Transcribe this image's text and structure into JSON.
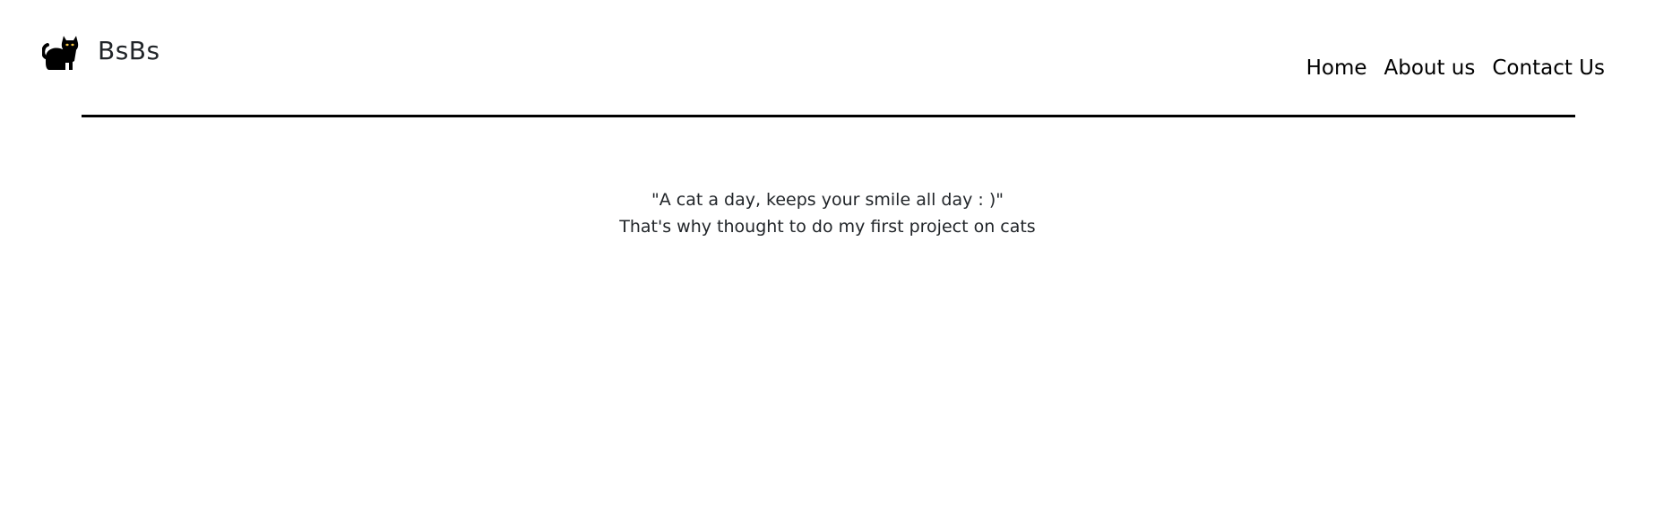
{
  "brand": {
    "icon": "cat-icon",
    "name": "BsBs"
  },
  "nav": {
    "items": [
      {
        "label": "Home"
      },
      {
        "label": "About us"
      },
      {
        "label": "Contact Us"
      }
    ]
  },
  "main": {
    "quote": "\"A cat a day, keeps your smile all day : )\"",
    "subtext": "That's why thought to do my first project on cats"
  },
  "colors": {
    "background": "#ffffff",
    "text": "#212529",
    "nav_text": "#000000",
    "divider": "#000000"
  }
}
